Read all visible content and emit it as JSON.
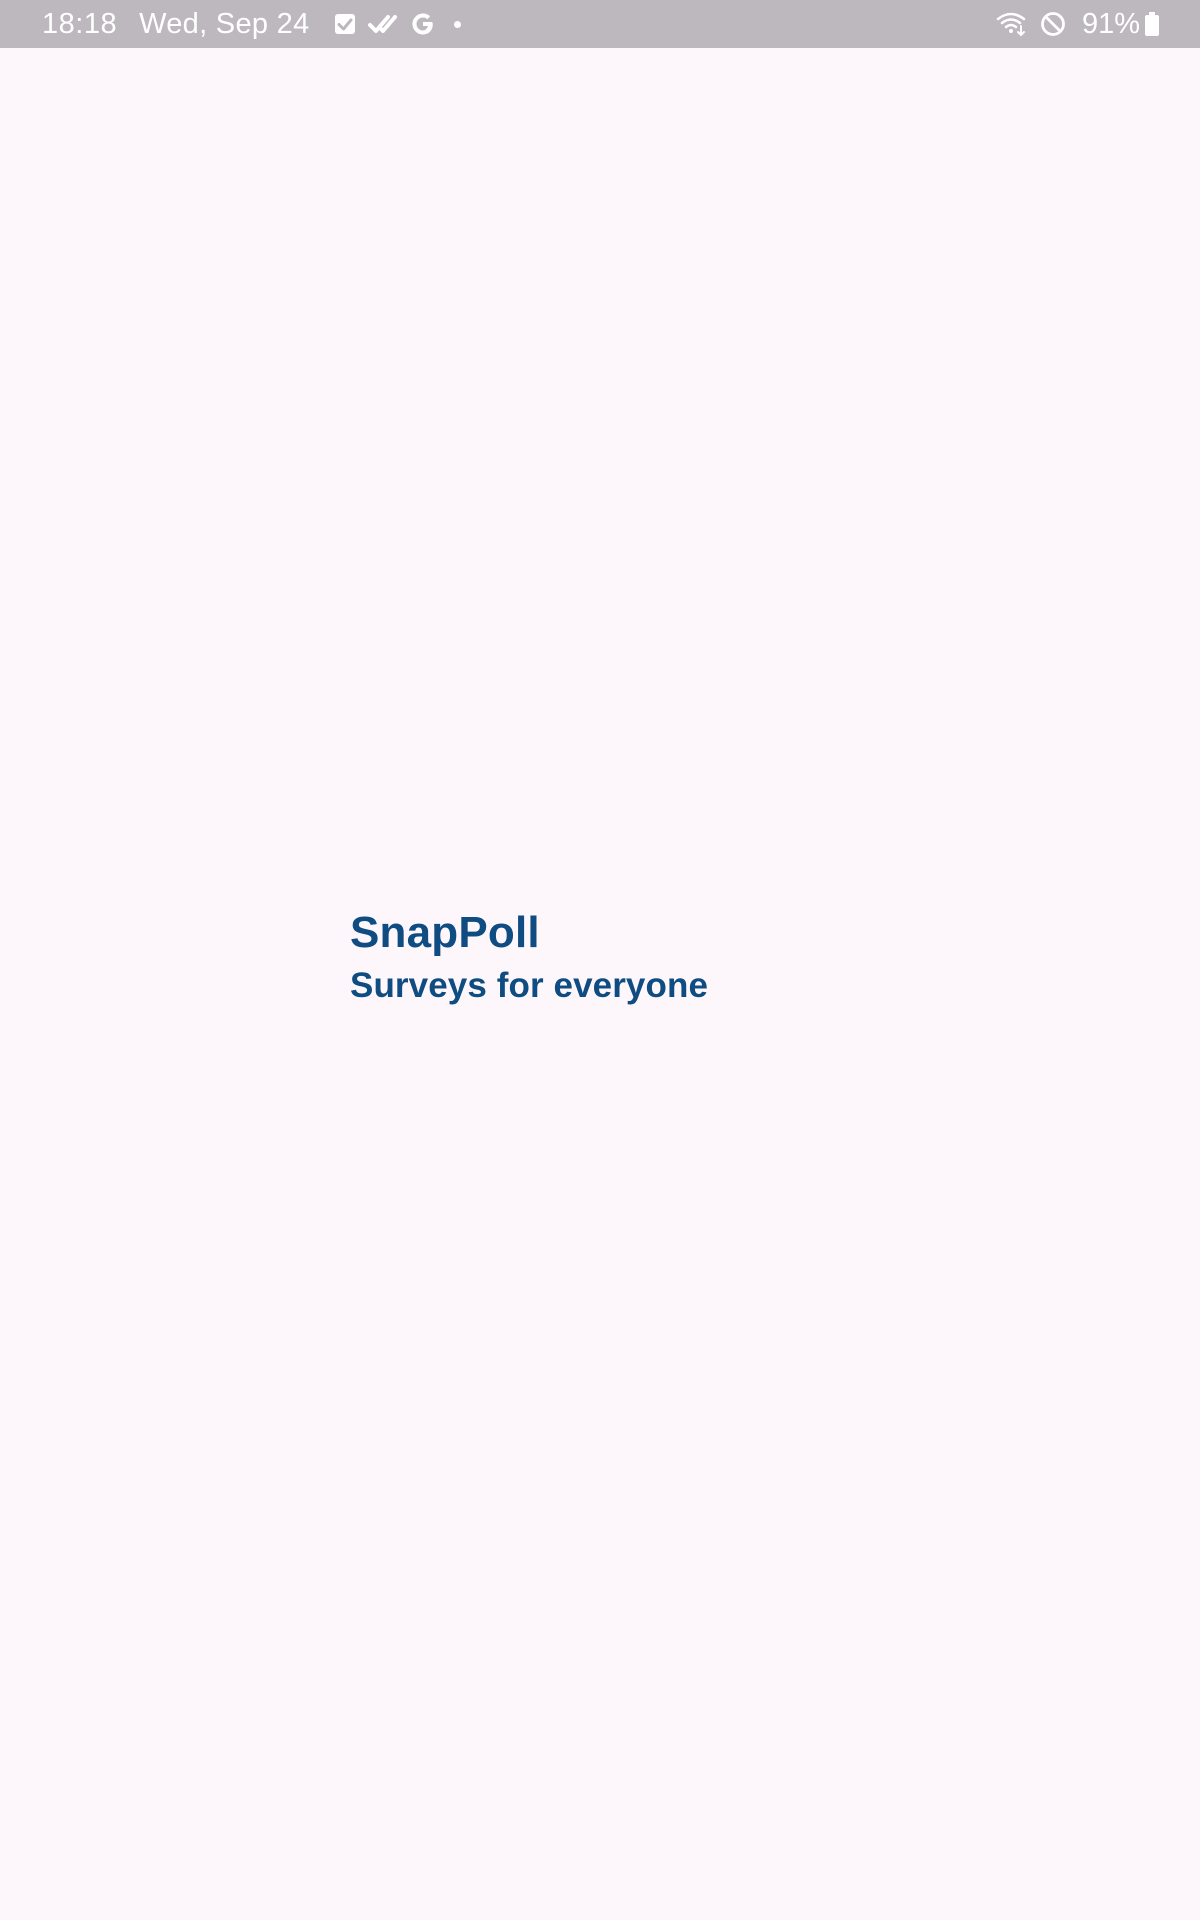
{
  "status_bar": {
    "time": "18:18",
    "date": "Wed, Sep 24",
    "battery_percent": "91%",
    "icons": [
      "checkbox-icon",
      "double-check-icon",
      "google-icon",
      "notification-dot-icon",
      "wifi-icon",
      "do-not-disturb-icon",
      "battery-icon"
    ],
    "background_color": "#bcb8be"
  },
  "splash": {
    "app_name": "SnapPoll",
    "tagline": "Surveys for everyone",
    "brand_color": "#0f4c81",
    "background_color": "#fdf7fc"
  }
}
